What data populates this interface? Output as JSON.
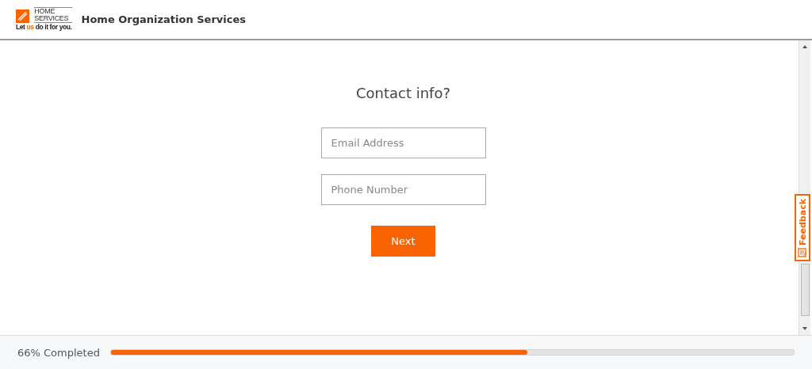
{
  "header": {
    "logo": {
      "line_1": "HOME",
      "line_2": "SERVICES",
      "tagline": [
        {
          "text": "Let",
          "highlight": false
        },
        {
          "text": "us",
          "highlight": true
        },
        {
          "text": "do it for you.",
          "highlight": false
        }
      ]
    },
    "title": "Home Organization Services"
  },
  "form": {
    "heading": "Contact info?",
    "fields": [
      {
        "placeholder": "Email Address"
      },
      {
        "placeholder": "Phone Number"
      }
    ],
    "button": "Next"
  },
  "feedback": "Feedback",
  "progress": {
    "label": "66% Completed",
    "level": 0.61
  }
}
